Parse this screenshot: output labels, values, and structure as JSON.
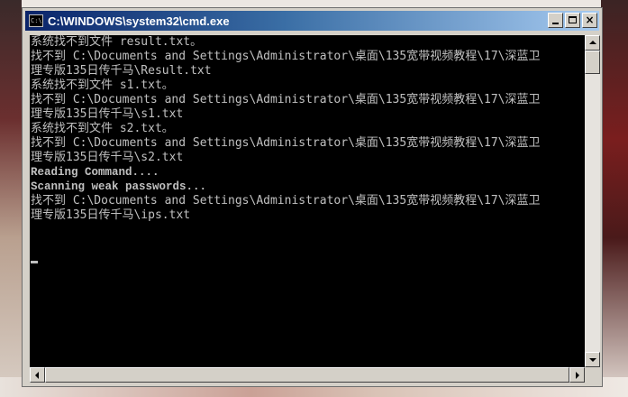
{
  "window": {
    "title": "C:\\WINDOWS\\system32\\cmd.exe",
    "icon_text": "C:\\",
    "buttons": {
      "minimize": "minimize",
      "maximize": "maximize",
      "close": "×"
    }
  },
  "console": {
    "lines": [
      "系统找不到文件 result.txt。",
      "找不到 C:\\Documents and Settings\\Administrator\\桌面\\135宽带视频教程\\17\\深蓝卫",
      "理专版135日传千马\\Result.txt",
      "系统找不到文件 s1.txt。",
      "找不到 C:\\Documents and Settings\\Administrator\\桌面\\135宽带视频教程\\17\\深蓝卫",
      "理专版135日传千马\\s1.txt",
      "系统找不到文件 s2.txt。",
      "找不到 C:\\Documents and Settings\\Administrator\\桌面\\135宽带视频教程\\17\\深蓝卫",
      "理专版135日传千马\\s2.txt",
      "Reading Command....",
      "Scanning weak passwords...",
      "找不到 C:\\Documents and Settings\\Administrator\\桌面\\135宽带视频教程\\17\\深蓝卫",
      "理专版135日传千马\\ips.txt"
    ]
  },
  "colors": {
    "console_bg": "#000000",
    "console_text": "#c0c0c0",
    "title_gradient_start": "#0a246a",
    "title_gradient_end": "#a6caf0"
  }
}
